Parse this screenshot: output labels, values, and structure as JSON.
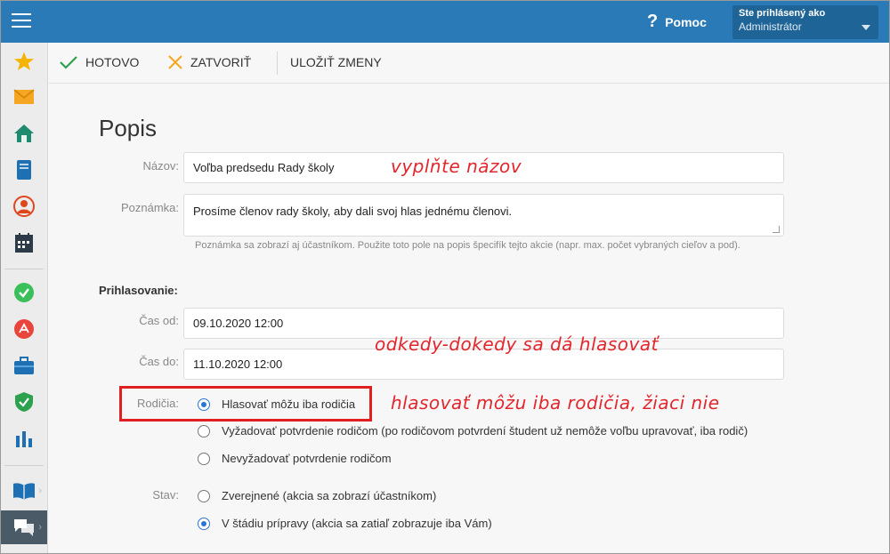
{
  "header": {
    "help_label": "Pomoc",
    "user_line1": "Ste prihlásený ako",
    "user_line2": "Administrátor"
  },
  "toolbar": {
    "done_label": "HOTOVO",
    "close_label": "ZATVORIŤ",
    "save_label": "ULOŽIŤ ZMENY"
  },
  "sidebar": {
    "icons": [
      "star-icon",
      "mail-icon",
      "home-icon",
      "notebook-icon",
      "user-icon",
      "calendar-icon",
      "check-badge-icon",
      "pen-icon",
      "briefcase-icon",
      "shield-icon",
      "bar-chart-icon",
      "book-icon",
      "chat-icon"
    ]
  },
  "form": {
    "title": "Popis",
    "name_label": "Názov:",
    "name_value": "Voľba predsedu Rady školy",
    "note_label": "Poznámka:",
    "note_value": "Prosíme členov rady školy, aby dali svoj hlas jednému členovi.",
    "note_hint": "Poznámka sa zobrazí aj účastníkom. Použite toto pole na popis špecifík tejto akcie (napr. max. počet vybraných cieľov a pod).",
    "signup_title": "Prihlasovanie:",
    "from_label": "Čas od:",
    "from_value": "09.10.2020 12:00",
    "to_label": "Čas do:",
    "to_value": "11.10.2020 12:00",
    "parents_label": "Rodičia:",
    "parents_options": [
      "Hlasovať môžu iba rodičia",
      "Vyžadovať potvrdenie rodičom (po rodičovom potvrdení študent už nemôže voľbu upravovať, iba rodič)",
      "Nevyžadovať potvrdenie rodičom"
    ],
    "parents_selected": 0,
    "status_label": "Stav:",
    "status_options": [
      "Zverejnené (akcia sa zobrazí účastníkom)",
      "V štádiu prípravy (akcia sa zatiaľ zobrazuje iba Vám)"
    ],
    "status_selected": 1
  },
  "annotations": {
    "name_note": "vyplňte názov",
    "time_note": "odkedy-dokedy sa dá hlasovať",
    "parents_note": "hlasovať môžu iba rodičia, žiaci nie"
  },
  "colors": {
    "topbar": "#2a7ab8",
    "accent": "#2b76d2",
    "annotation_red": "#e3262d"
  }
}
